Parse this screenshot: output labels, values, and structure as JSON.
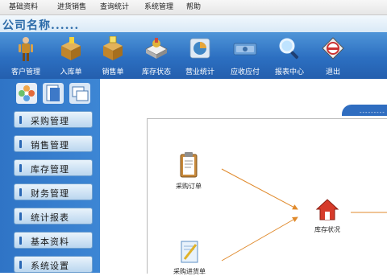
{
  "menu": {
    "items": [
      "基础资料",
      "进货销售",
      "查询统计",
      "系统管理",
      "帮助"
    ]
  },
  "header": {
    "company_name": "公司名称......"
  },
  "toolbar": {
    "buttons": [
      {
        "label": "客户管理",
        "icon": "customer-figure-icon"
      },
      {
        "label": "入库单",
        "icon": "box-in-icon"
      },
      {
        "label": "销售单",
        "icon": "box-out-icon"
      },
      {
        "label": "库存状态",
        "icon": "stock-icon"
      },
      {
        "label": "营业统计",
        "icon": "pie-chart-icon"
      },
      {
        "label": "应收应付",
        "icon": "money-icon"
      },
      {
        "label": "报表中心",
        "icon": "magnifier-icon"
      },
      {
        "label": "退出",
        "icon": "exit-sign-icon"
      }
    ]
  },
  "sidebar": {
    "items": [
      {
        "label": "采购管理"
      },
      {
        "label": "销售管理"
      },
      {
        "label": "库存管理"
      },
      {
        "label": "财务管理"
      },
      {
        "label": "统计报表"
      },
      {
        "label": "基本资料"
      },
      {
        "label": "系统设置"
      }
    ]
  },
  "main": {
    "tab_label": "----------",
    "flow": {
      "purchase_order": "采购订单",
      "stock_status": "库存状况",
      "purchase_inbound": "采购进货单"
    }
  },
  "colors": {
    "toolbar_blue": "#2c6fc1",
    "sidebar_blue": "#3479c9",
    "company_text": "#2b6aa8",
    "arrow": "#e08a2c"
  }
}
